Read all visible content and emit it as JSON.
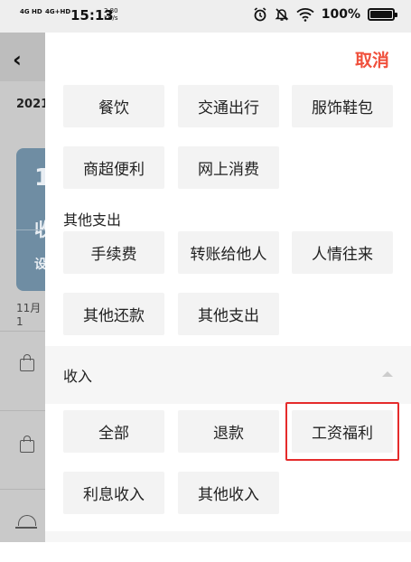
{
  "status_bar": {
    "net1": "4G HD",
    "net2": "4G+HD",
    "time": "15:13",
    "speed_value": "2.80",
    "speed_unit": "KB/s",
    "battery": "100%"
  },
  "background": {
    "back_icon": "chevron-left-icon",
    "date": "2021.",
    "card_big": "1",
    "card_line1": "收",
    "card_line2": "设",
    "date2": "11月1"
  },
  "sheet": {
    "cancel": "取消",
    "expense_rows": [
      [
        "餐饮",
        "交通出行",
        "服饰鞋包"
      ],
      [
        "商超便利",
        "网上消费"
      ]
    ],
    "other_expense_title": "其他支出",
    "other_expense": [
      [
        "手续费",
        "转账给他人",
        "人情往来"
      ],
      [
        "其他还款",
        "其他支出"
      ]
    ],
    "income_title": "收入",
    "income": [
      [
        "全部",
        "退款",
        "工资福利"
      ],
      [
        "利息收入",
        "其他收入"
      ]
    ]
  },
  "colors": {
    "accent": "#f0503c",
    "highlight": "#e52b2b"
  }
}
